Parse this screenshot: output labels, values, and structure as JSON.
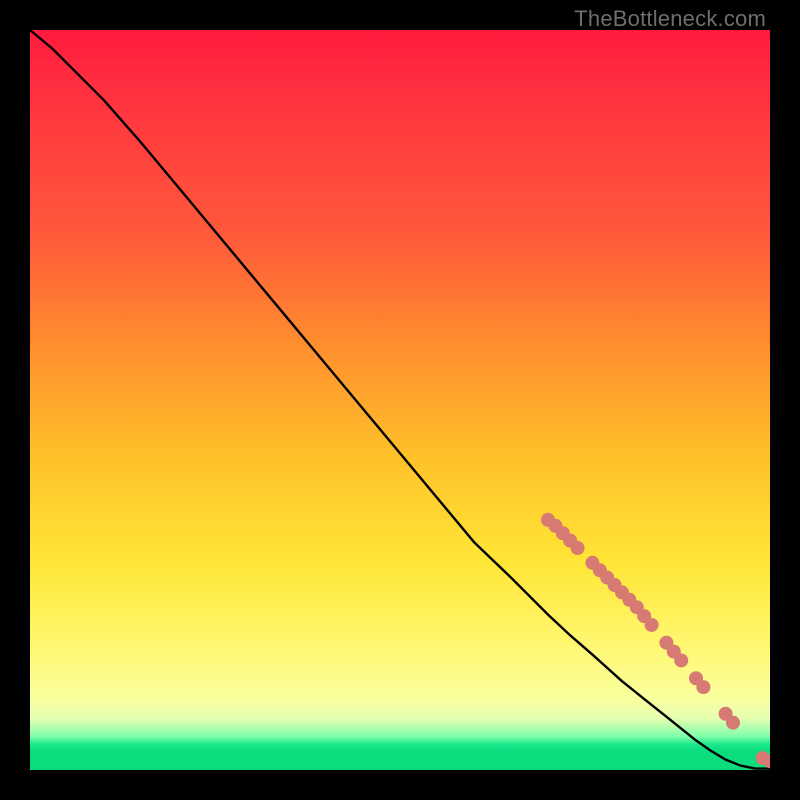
{
  "watermark": "TheBottleneck.com",
  "colors": {
    "curve": "#000000",
    "marker_fill": "#d77a73",
    "marker_stroke": "#9c5049",
    "background_black": "#000000"
  },
  "chart_data": {
    "type": "line",
    "title": "",
    "xlabel": "",
    "ylabel": "",
    "xlim": [
      0,
      100
    ],
    "ylim": [
      0,
      100
    ],
    "grid": false,
    "legend": false,
    "series": [
      {
        "name": "curve",
        "x": [
          0,
          3,
          6,
          10,
          15,
          20,
          25,
          30,
          35,
          40,
          45,
          50,
          55,
          60,
          65,
          70,
          73,
          76,
          78,
          80,
          82,
          84,
          86,
          88,
          90,
          92,
          94,
          96,
          98,
          100
        ],
        "y": [
          100,
          97.5,
          94.5,
          90.5,
          84.8,
          78.8,
          72.8,
          66.8,
          60.8,
          54.8,
          48.8,
          42.8,
          36.8,
          30.8,
          26.0,
          21.0,
          18.2,
          15.6,
          13.8,
          12.0,
          10.4,
          8.8,
          7.2,
          5.6,
          4.0,
          2.6,
          1.4,
          0.6,
          0.2,
          0.2
        ]
      }
    ],
    "markers": {
      "name": "cluster",
      "x": [
        70,
        71,
        72,
        73,
        74,
        76,
        77,
        78,
        79,
        80,
        81,
        82,
        83,
        84,
        86,
        87,
        88,
        90,
        91,
        94,
        95,
        99,
        100
      ],
      "y": [
        33.8,
        33.0,
        32.0,
        31.0,
        30.0,
        28.0,
        27.0,
        26.0,
        25.0,
        24.0,
        23.0,
        22.0,
        20.8,
        19.6,
        17.2,
        16.0,
        14.8,
        12.4,
        11.2,
        7.6,
        6.4,
        1.6,
        1.2
      ]
    }
  }
}
